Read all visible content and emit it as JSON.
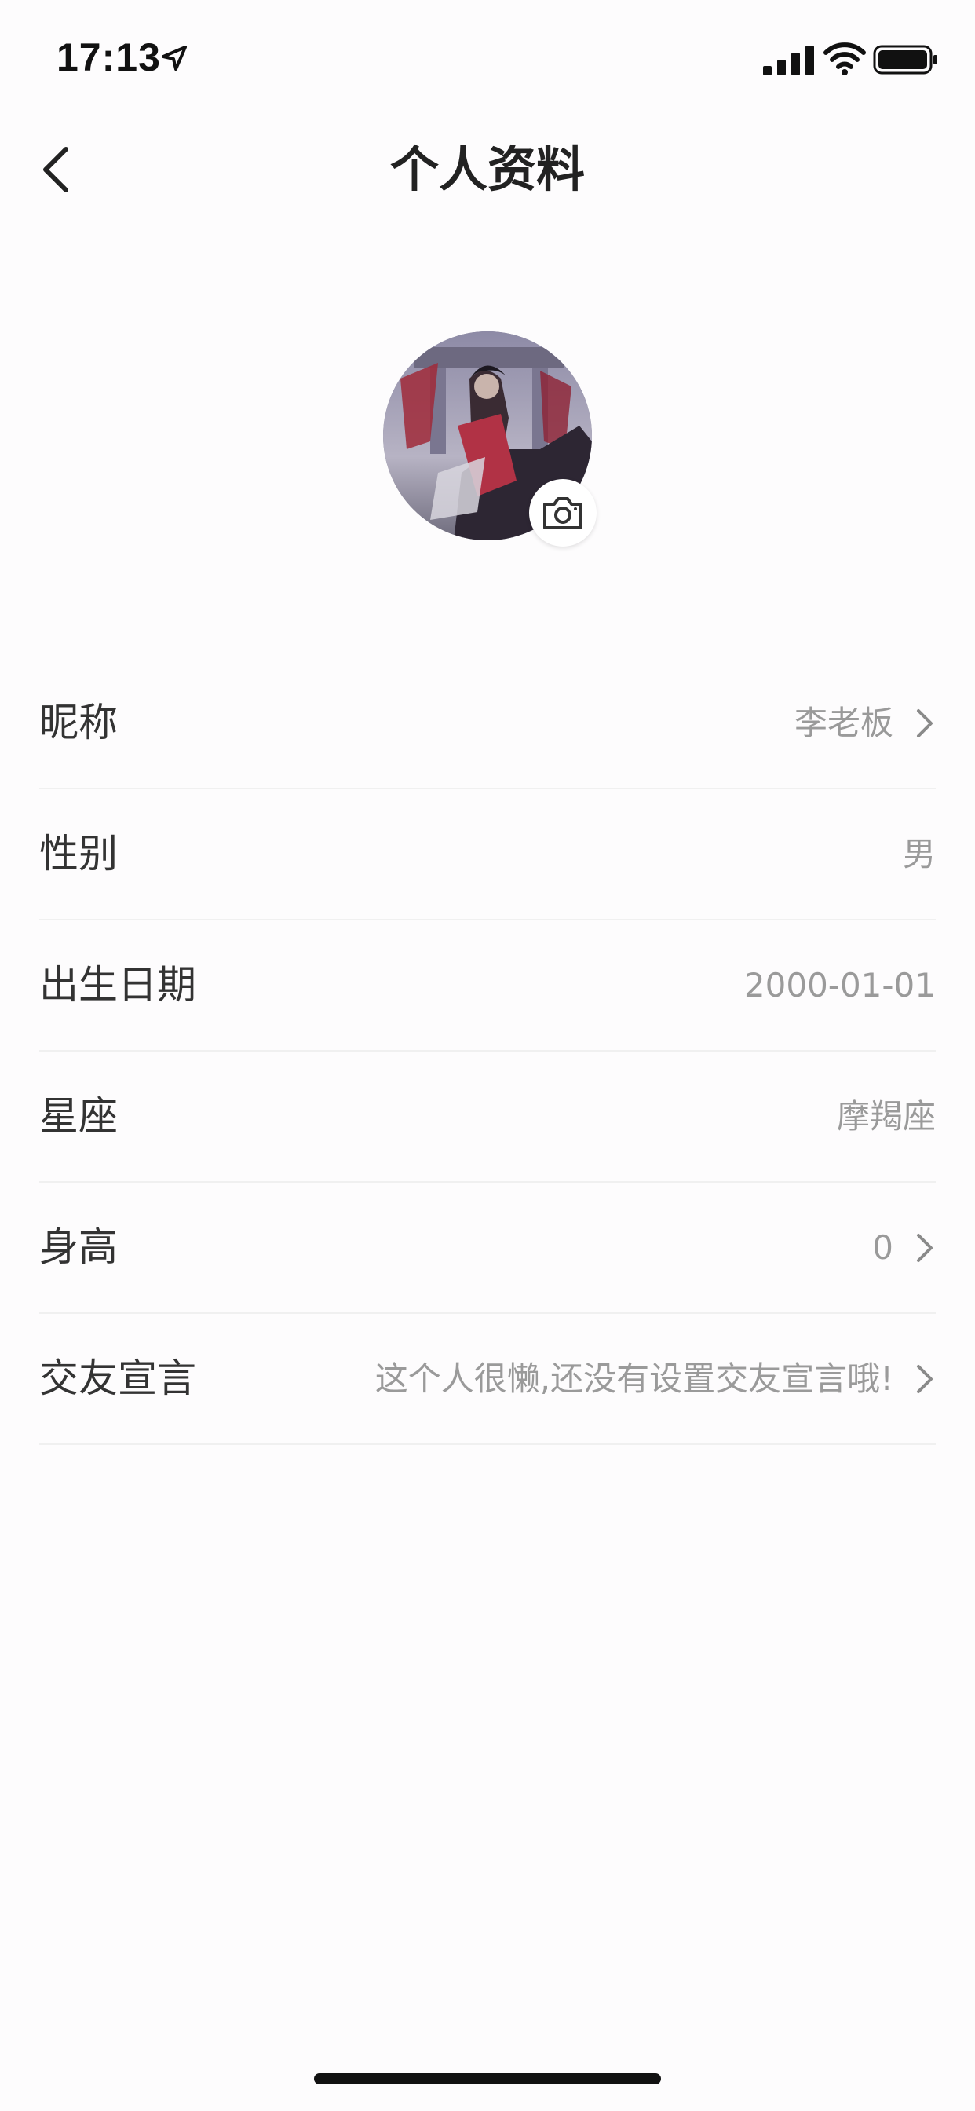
{
  "status_bar": {
    "time": "17:13",
    "icons": [
      "location-arrow-icon",
      "cellular-signal-icon",
      "wifi-icon",
      "battery-icon"
    ]
  },
  "nav": {
    "title": "个人资料",
    "back_icon": "chevron-left-icon"
  },
  "profile": {
    "avatar_icon": "avatar-image",
    "camera_icon": "camera-icon"
  },
  "rows": [
    {
      "label": "昵称",
      "value": "李老板",
      "arrow": true
    },
    {
      "label": "性别",
      "value": "男",
      "arrow": false
    },
    {
      "label": "出生日期",
      "value": "2000-01-01",
      "arrow": false
    },
    {
      "label": "星座",
      "value": "摩羯座",
      "arrow": false
    },
    {
      "label": "身高",
      "value": "0",
      "arrow": true
    },
    {
      "label": "交友宣言",
      "value": "这个人很懒,还没有设置交友宣言哦!",
      "arrow": true
    }
  ],
  "colors": {
    "background": "#fdfcfd",
    "text_primary": "#333333",
    "text_secondary": "#9a9a9a",
    "divider": "#f0f0f0"
  }
}
